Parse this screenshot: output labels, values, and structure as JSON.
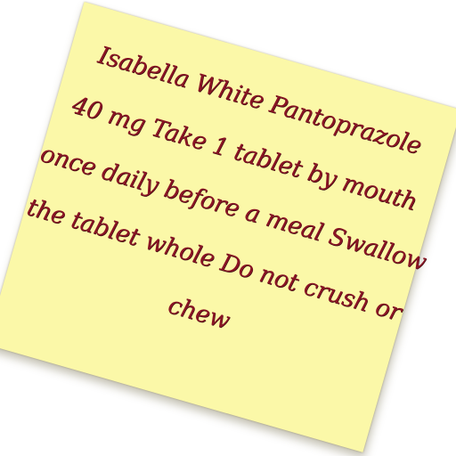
{
  "note": {
    "lines": [
      "Isabella White Pantoprazole",
      "40 mg Take 1 tablet by mouth",
      "once daily before a meal Swallow",
      "the tablet whole Do not crush or",
      "chew"
    ]
  },
  "colors": {
    "paper": "#fbf8a8",
    "ink": "#8a1424",
    "background": "#ffffff"
  }
}
